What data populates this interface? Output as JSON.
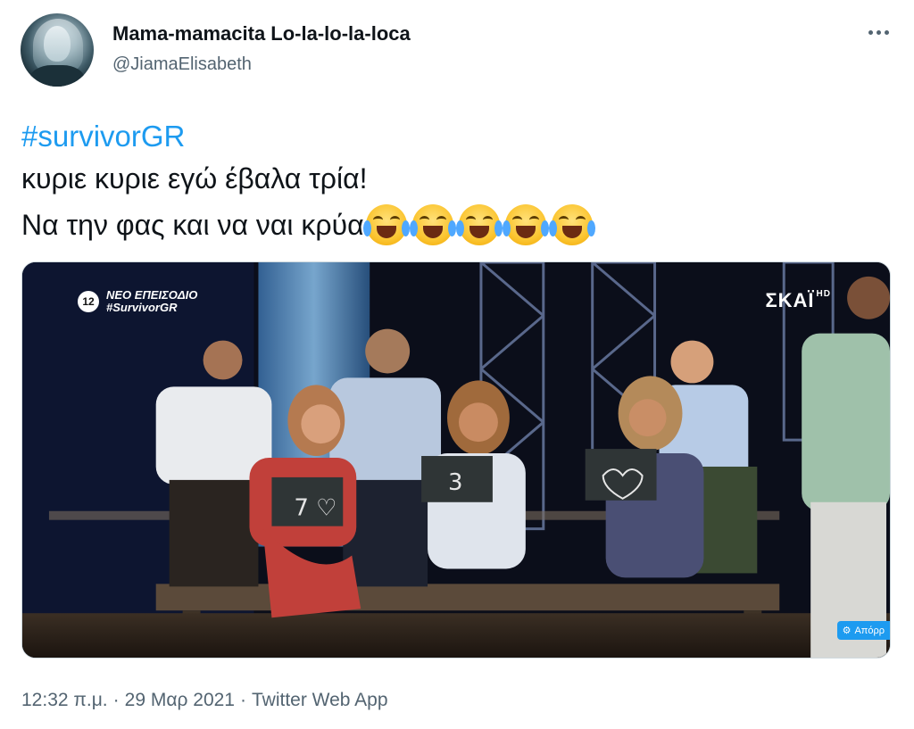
{
  "author": {
    "display_name": "Mama-mamacita Lo-la-lo-la-loca",
    "handle": "@JiamaElisabeth"
  },
  "tweet": {
    "hashtag": "#survivorGR",
    "line1": "κυριε κυριε εγώ έβαλα τρία!",
    "line2": "Να την φας και να ναι κρύα",
    "emoji": [
      "face-with-tears-of-joy",
      "face-with-tears-of-joy",
      "face-with-tears-of-joy",
      "face-with-tears-of-joy",
      "face-with-tears-of-joy"
    ]
  },
  "media": {
    "overlay_badge_number": "12",
    "overlay_badge_line1": "ΝΕΟ ΕΠΕΙΣΟΔΙΟ",
    "overlay_badge_line2": "#SurvivorGR",
    "channel_logo": "ΣΚΑΪ",
    "channel_logo_suffix": "HD",
    "chip_label": "Απόρρ",
    "sign_texts": [
      "7",
      "3"
    ]
  },
  "footer": {
    "time": "12:32 π.μ.",
    "date": "29 Μαρ 2021",
    "source": "Twitter Web App",
    "separator": "·"
  },
  "colors": {
    "accent": "#1d9bf0",
    "text": "#0f1419",
    "secondary": "#536471"
  }
}
